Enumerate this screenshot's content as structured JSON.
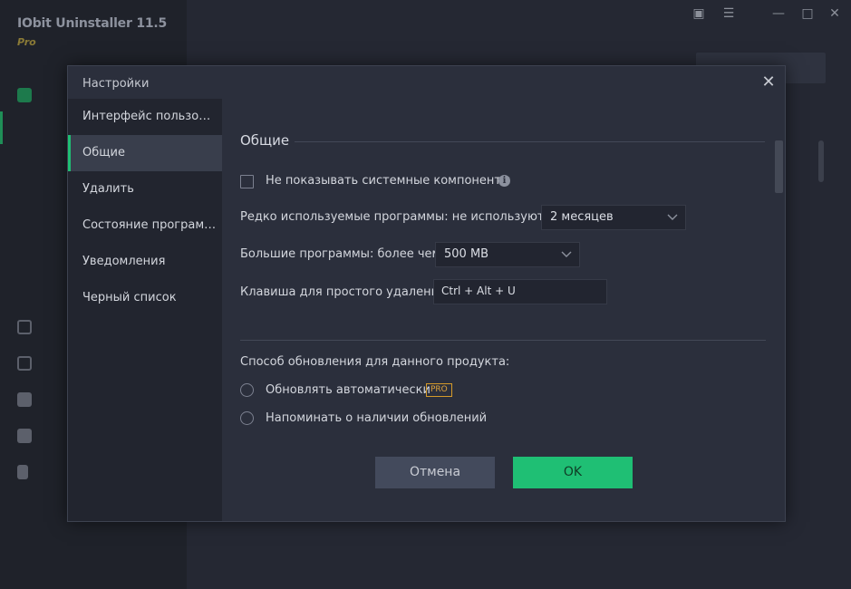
{
  "app": {
    "title": "IObit Uninstaller 11.5",
    "edition": "Pro"
  },
  "dialog": {
    "title": "Настройки",
    "nav": [
      {
        "label": "Интерфейс пользователя",
        "active": false
      },
      {
        "label": "Общие",
        "active": true
      },
      {
        "label": "Удалить",
        "active": false
      },
      {
        "label": "Состояние программы",
        "active": false
      },
      {
        "label": "Уведомления",
        "active": false
      },
      {
        "label": "Черный список",
        "active": false
      }
    ],
    "section_title": "Общие",
    "hide_system_components_label": "Не показывать системные компоненты",
    "hide_system_components_checked": false,
    "rarely_used_label": "Редко используемые программы: не используются",
    "rarely_used_value": "2 месяцев",
    "large_programs_label": "Большие программы: более чем",
    "large_programs_value": "500 MB",
    "hotkey_label": "Клавиша для простого удаления",
    "hotkey_value": "Ctrl + Alt + U",
    "update_method_label": "Способ обновления для данного продукта:",
    "update_auto_label": "Обновлять автоматически",
    "pro_badge": "PRO",
    "update_remind_label": "Напоминать о наличии обновлений",
    "cancel_label": "Отмена",
    "ok_label": "OK"
  },
  "colors": {
    "accent": "#1fbf74",
    "pro_badge": "#e0a43a",
    "dialog_bg": "#2b2f3c",
    "sidebar_bg": "#22252f"
  }
}
